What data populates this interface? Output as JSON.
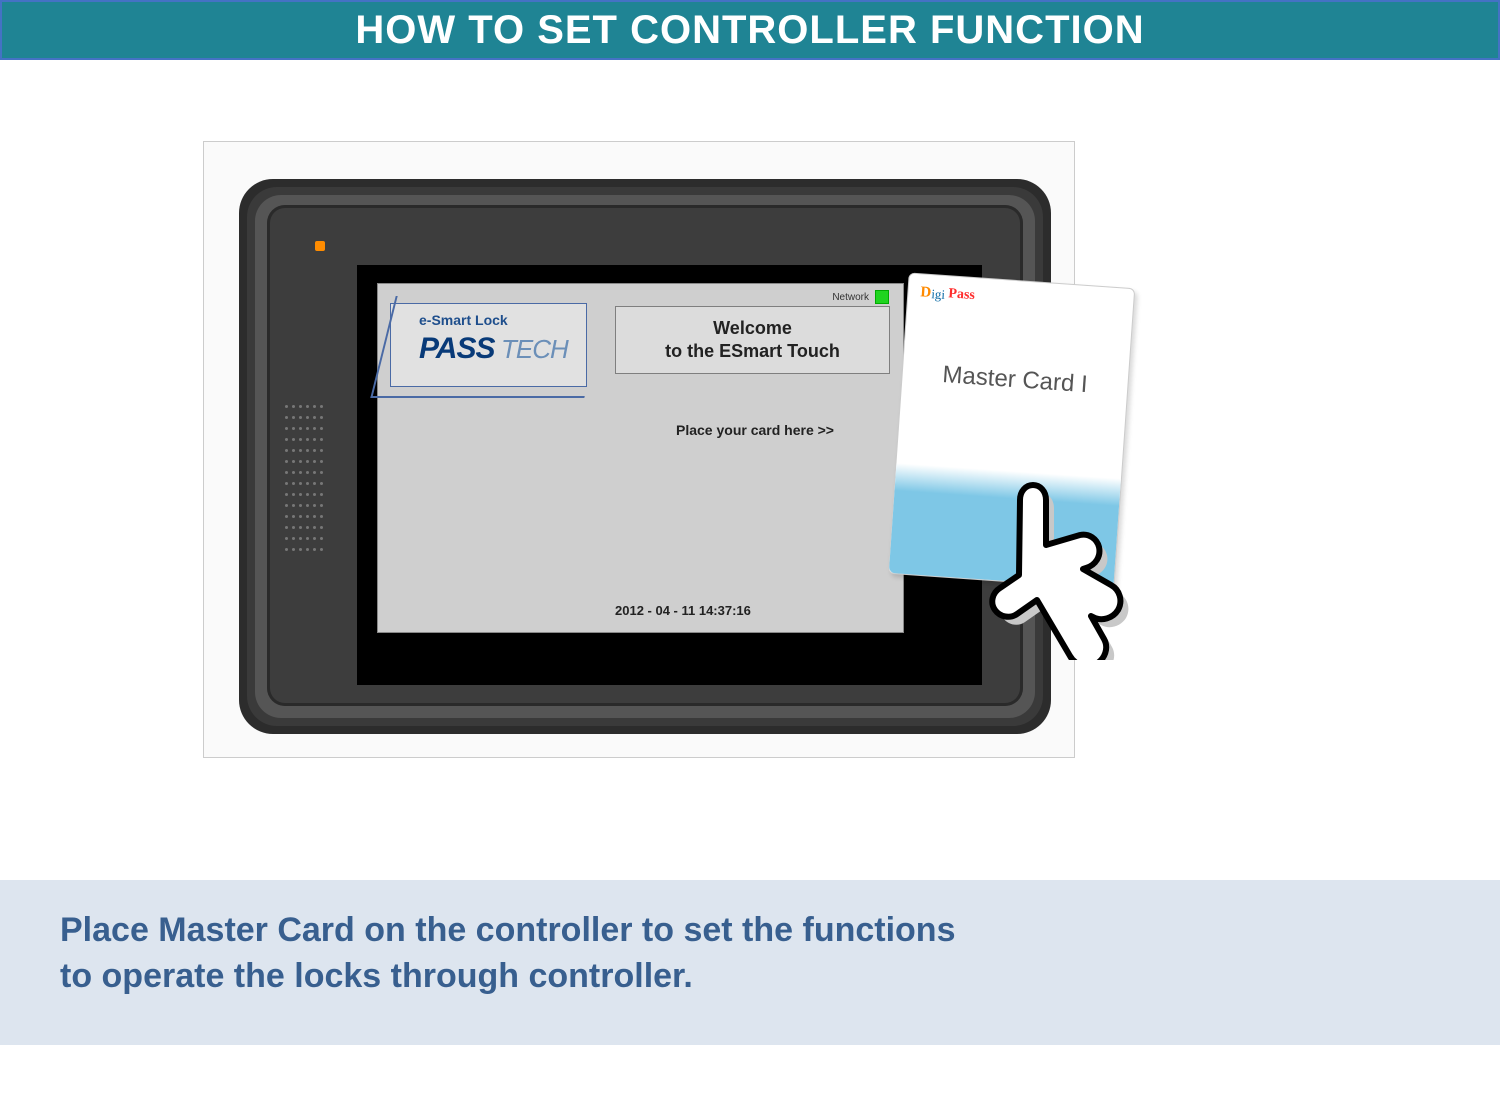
{
  "title": "HOW TO SET CONTROLLER FUNCTION",
  "device": {
    "logo_small": "e-Smart Lock",
    "logo_pass": "PASS",
    "logo_tech": "TECH",
    "network_label": "Network",
    "welcome_l1": "Welcome",
    "welcome_l2": "to the ESmart Touch",
    "place_prompt": "Place your card here >>",
    "timestamp": "2012 - 04 - 11 14:37:16"
  },
  "card": {
    "brand_d": "D",
    "brand_igi": "igi",
    "brand_pass": "Pass",
    "title": "Master Card  I"
  },
  "footer_l1": "Place Master Card on the controller to set the functions",
  "footer_l2": "to operate the locks through  controller."
}
